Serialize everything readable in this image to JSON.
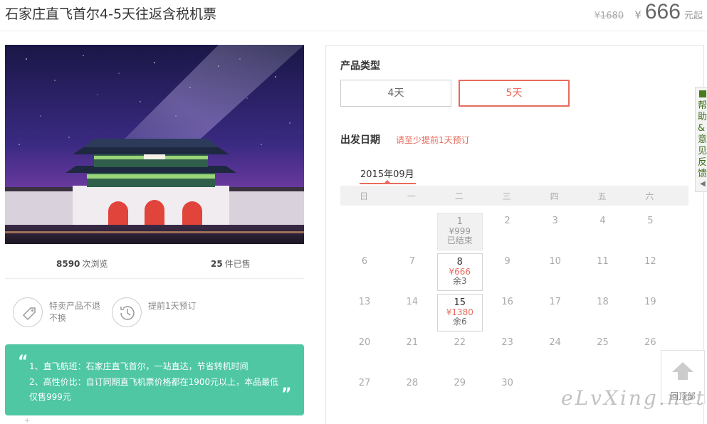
{
  "header": {
    "title": "石家庄直飞首尔4-5天往返含税机票",
    "old_price": "¥1680",
    "currency": "¥",
    "price": "666",
    "price_unit": "元起"
  },
  "stats": {
    "views_count": "8590",
    "views_label": "次浏览",
    "sold_count": "25",
    "sold_label": "件已售"
  },
  "features": [
    {
      "icon": "tag-icon",
      "text": "特卖产品不退不换"
    },
    {
      "icon": "history-clock-icon",
      "text": "提前1天预订"
    }
  ],
  "promo": {
    "line1": "1、直飞航班：石家庄直飞首尔，一站直达，节省转机时间",
    "line2": "2、高性价比：自订同期直飞机票价格都在1900元以上，本品最低",
    "line3": "仅售999元"
  },
  "booking": {
    "type_label": "产品类型",
    "types": [
      {
        "label": "4天",
        "selected": false
      },
      {
        "label": "5天",
        "selected": true
      }
    ],
    "date_label": "出发日期",
    "date_hint": "请至少提前1天预订",
    "month": "2015年09月",
    "weekdays": [
      "日",
      "一",
      "二",
      "三",
      "四",
      "五",
      "六"
    ],
    "days": [
      {
        "day": "1",
        "col": 2,
        "week": 0,
        "state": "ended",
        "price": "¥999",
        "status": "已结束"
      },
      {
        "day": "2",
        "col": 3,
        "week": 0
      },
      {
        "day": "3",
        "col": 4,
        "week": 0
      },
      {
        "day": "4",
        "col": 5,
        "week": 0
      },
      {
        "day": "5",
        "col": 6,
        "week": 0
      },
      {
        "day": "6",
        "col": 0,
        "week": 1
      },
      {
        "day": "7",
        "col": 1,
        "week": 1
      },
      {
        "day": "8",
        "col": 2,
        "week": 1,
        "state": "bookable",
        "price": "¥666",
        "status": "余3"
      },
      {
        "day": "9",
        "col": 3,
        "week": 1
      },
      {
        "day": "10",
        "col": 4,
        "week": 1
      },
      {
        "day": "11",
        "col": 5,
        "week": 1
      },
      {
        "day": "12",
        "col": 6,
        "week": 1
      },
      {
        "day": "13",
        "col": 0,
        "week": 2
      },
      {
        "day": "14",
        "col": 1,
        "week": 2
      },
      {
        "day": "15",
        "col": 2,
        "week": 2,
        "state": "bookable",
        "price": "¥1380",
        "status": "余6"
      },
      {
        "day": "16",
        "col": 3,
        "week": 2
      },
      {
        "day": "17",
        "col": 4,
        "week": 2
      },
      {
        "day": "18",
        "col": 5,
        "week": 2
      },
      {
        "day": "19",
        "col": 6,
        "week": 2
      },
      {
        "day": "20",
        "col": 0,
        "week": 3
      },
      {
        "day": "21",
        "col": 1,
        "week": 3
      },
      {
        "day": "22",
        "col": 2,
        "week": 3
      },
      {
        "day": "23",
        "col": 3,
        "week": 3
      },
      {
        "day": "24",
        "col": 4,
        "week": 3
      },
      {
        "day": "25",
        "col": 5,
        "week": 3
      },
      {
        "day": "26",
        "col": 6,
        "week": 3
      },
      {
        "day": "27",
        "col": 0,
        "week": 4
      },
      {
        "day": "28",
        "col": 1,
        "week": 4
      },
      {
        "day": "29",
        "col": 2,
        "week": 4
      },
      {
        "day": "30",
        "col": 3,
        "week": 4
      }
    ]
  },
  "side": {
    "help_label": "帮助&意见反馈",
    "back_top_label": "回顶部"
  },
  "watermark": "eLvXing.net",
  "colors": {
    "accent": "#e96b5d",
    "promo_bg": "#4fc7a3",
    "help_green": "#3f6e18"
  }
}
